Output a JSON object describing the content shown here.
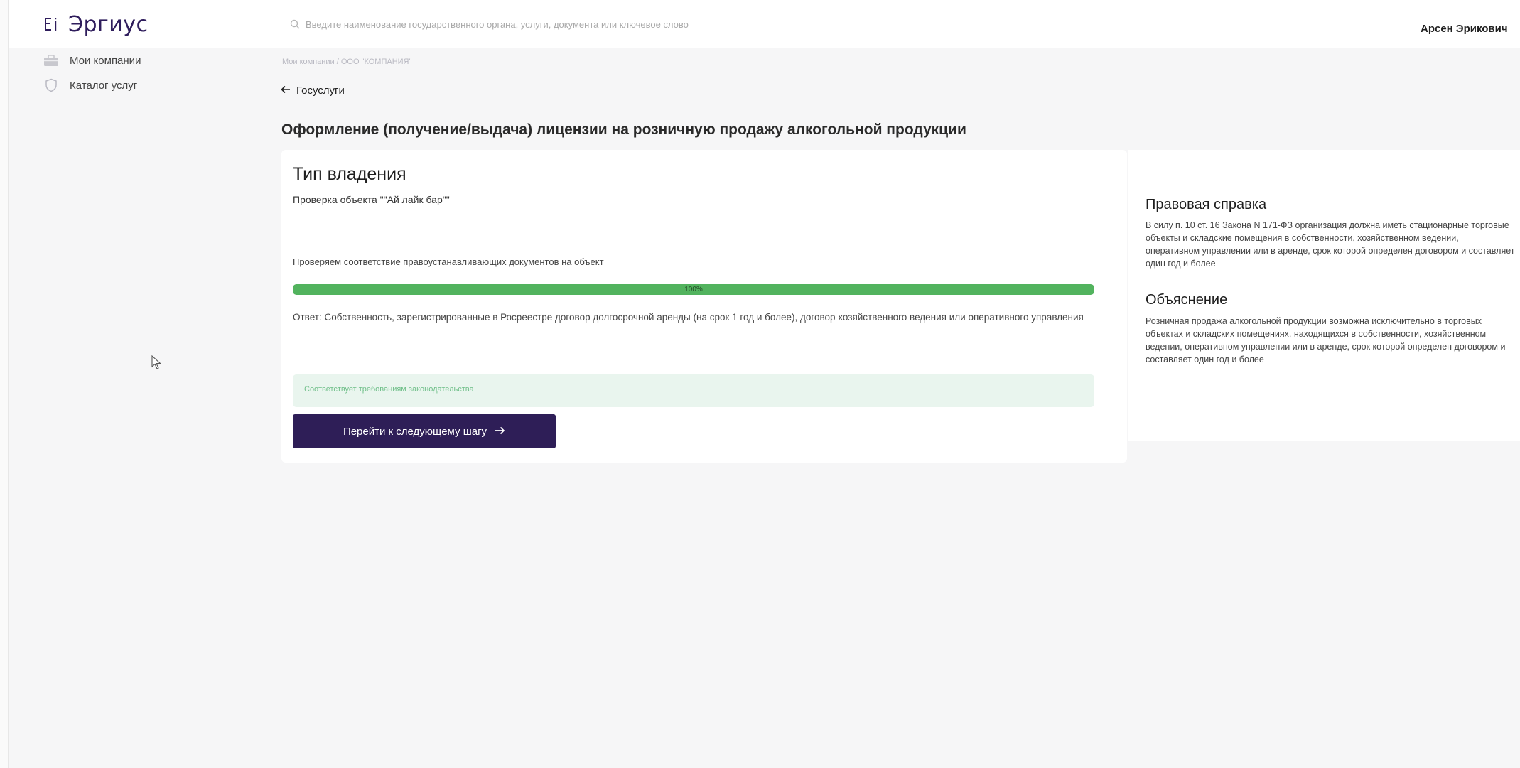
{
  "header": {
    "logo_text": "Эргиус",
    "search_placeholder": "Введите наименование государственного органа, услуги, документа или ключевое слово",
    "user_name": "Арсен Эрикович"
  },
  "sidebar": {
    "items": [
      {
        "label": "Мои компании",
        "icon": "briefcase-icon"
      },
      {
        "label": "Каталог услуг",
        "icon": "shield-icon"
      }
    ]
  },
  "main": {
    "breadcrumb": "Мои компании / ООО \"КОМПАНИЯ\"",
    "back_label": "Госуслуги",
    "page_title": "Оформление (получение/выдача) лицензии на розничную продажу алкогольной продукции",
    "card": {
      "title": "Тип владения",
      "object_check": "Проверка объекта \"\"Ай лайк бар\"\"",
      "verify_text": "Проверяем соответствие правоустанавливающих документов на объект",
      "progress_percent": 100,
      "progress_label": "100%",
      "answer": "Ответ: Собственность, зарегистрированные в Росреестре договор долгосрочной аренды (на срок 1 год и более), договор хозяйственного ведения или оперативного управления",
      "status": "Соответствует требованиям законодательства",
      "next_button": "Перейти к следующему шагу"
    },
    "reference": {
      "title": "Правовая справка",
      "text": "В силу п. 10 ст. 16 Закона N 171-ФЗ организация должна иметь стационарные торговые объекты и складские помещения в собственности, хозяйственном ведении, оперативном управлении или в аренде, срок которой определен договором и составляет один год и более"
    },
    "explanation": {
      "title": "Объяснение",
      "text": "Розничная продажа алкогольной продукции возможна исключительно в торговых объектах и складских помещениях, находящихся в собственности, хозяйственном ведении, оперативном управлении или в аренде, срок которой определен договором и составляет один год и более"
    }
  },
  "colors": {
    "brand": "#2e1e57",
    "progress": "#52b35e",
    "status_bg": "#e9f5ee",
    "status_text": "#6fbf89"
  }
}
